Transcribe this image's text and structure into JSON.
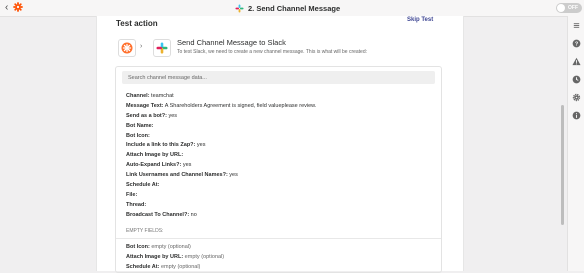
{
  "topbar": {
    "back_icon": "chevron-left",
    "zap_title": "2. Send Channel Message",
    "toggle_label": "OFF"
  },
  "panel": {
    "title": "Test action",
    "skip_label": "Skip Test",
    "header_title": "Send Channel Message to Slack",
    "header_sub": "To test Slack, we need to create a new channel message. This is what will be created:",
    "search_placeholder": "Search channel message data..."
  },
  "fields": [
    {
      "label": "Channel:",
      "value": " teamchat"
    },
    {
      "label": "Message Text:",
      "value": " A Shareholders Agreement is signed, field valueplease review."
    },
    {
      "label": "Send as a bot?:",
      "value": " yes"
    },
    {
      "label": "Bot Name:",
      "value": ""
    },
    {
      "label": "Bot Icon:",
      "value": ""
    },
    {
      "label": "Include a link to this Zap?:",
      "value": " yes"
    },
    {
      "label": "Attach Image by URL:",
      "value": ""
    },
    {
      "label": "Auto-Expand Links?:",
      "value": " yes"
    },
    {
      "label": "Link Usernames and Channel Names?:",
      "value": " yes"
    },
    {
      "label": "Schedule At:",
      "value": ""
    },
    {
      "label": "File:",
      "value": ""
    },
    {
      "label": "Thread:",
      "value": ""
    },
    {
      "label": "Broadcast To Channel?:",
      "value": " no"
    }
  ],
  "empty_header": "EMPTY FIELDS:",
  "empty_fields": [
    {
      "label": "Bot Icon:",
      "value": " empty (optional)"
    },
    {
      "label": "Attach Image by URL:",
      "value": " empty (optional)"
    },
    {
      "label": "Schedule At:",
      "value": " empty (optional)"
    }
  ],
  "rightbar_icons": [
    "list-icon",
    "help-icon",
    "warning-icon",
    "history-icon",
    "gear-icon",
    "info-icon"
  ],
  "colors": {
    "zapier_orange": "#ff4f00",
    "link_blue": "#3d4592"
  }
}
